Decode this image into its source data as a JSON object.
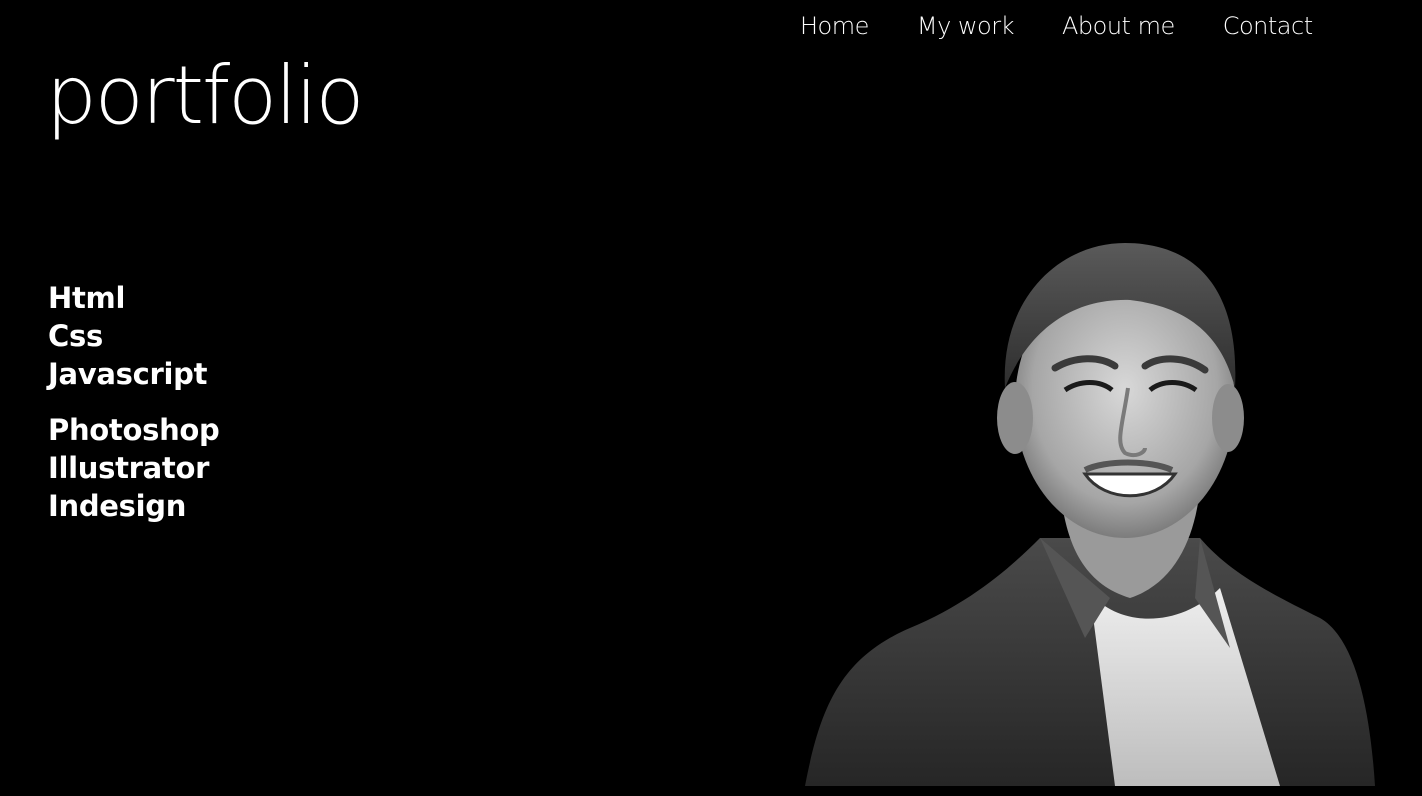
{
  "nav": {
    "items": [
      {
        "label": "Home"
      },
      {
        "label": "My work"
      },
      {
        "label": "About me"
      },
      {
        "label": "Contact"
      }
    ]
  },
  "logo": {
    "text": "portfolio"
  },
  "skills": {
    "dev": [
      "Html",
      "Css",
      "Javascript"
    ],
    "design": [
      "Photoshop",
      "Illustrator",
      "Indesign"
    ]
  },
  "portrait": {
    "subject": "smiling man in denim shirt, black and white photo"
  }
}
